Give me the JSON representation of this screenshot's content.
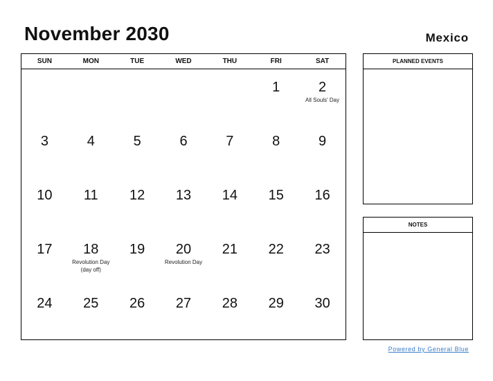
{
  "header": {
    "title": "November 2030",
    "country": "Mexico"
  },
  "calendar": {
    "weekdays": [
      "SUN",
      "MON",
      "TUE",
      "WED",
      "THU",
      "FRI",
      "SAT"
    ],
    "weeks": [
      [
        {
          "day": "",
          "event": ""
        },
        {
          "day": "",
          "event": ""
        },
        {
          "day": "",
          "event": ""
        },
        {
          "day": "",
          "event": ""
        },
        {
          "day": "",
          "event": ""
        },
        {
          "day": "1",
          "event": ""
        },
        {
          "day": "2",
          "event": "All Souls' Day"
        }
      ],
      [
        {
          "day": "3",
          "event": ""
        },
        {
          "day": "4",
          "event": ""
        },
        {
          "day": "5",
          "event": ""
        },
        {
          "day": "6",
          "event": ""
        },
        {
          "day": "7",
          "event": ""
        },
        {
          "day": "8",
          "event": ""
        },
        {
          "day": "9",
          "event": ""
        }
      ],
      [
        {
          "day": "10",
          "event": ""
        },
        {
          "day": "11",
          "event": ""
        },
        {
          "day": "12",
          "event": ""
        },
        {
          "day": "13",
          "event": ""
        },
        {
          "day": "14",
          "event": ""
        },
        {
          "day": "15",
          "event": ""
        },
        {
          "day": "16",
          "event": ""
        }
      ],
      [
        {
          "day": "17",
          "event": ""
        },
        {
          "day": "18",
          "event": "Revolution Day (day off)"
        },
        {
          "day": "19",
          "event": ""
        },
        {
          "day": "20",
          "event": "Revolution Day"
        },
        {
          "day": "21",
          "event": ""
        },
        {
          "day": "22",
          "event": ""
        },
        {
          "day": "23",
          "event": ""
        }
      ],
      [
        {
          "day": "24",
          "event": ""
        },
        {
          "day": "25",
          "event": ""
        },
        {
          "day": "26",
          "event": ""
        },
        {
          "day": "27",
          "event": ""
        },
        {
          "day": "28",
          "event": ""
        },
        {
          "day": "29",
          "event": ""
        },
        {
          "day": "30",
          "event": ""
        }
      ]
    ]
  },
  "panels": {
    "planned_events": "PLANNED EVENTS",
    "notes": "NOTES"
  },
  "footer": {
    "link_text": "Powered by General Blue",
    "link_color": "#3a7bc8"
  }
}
